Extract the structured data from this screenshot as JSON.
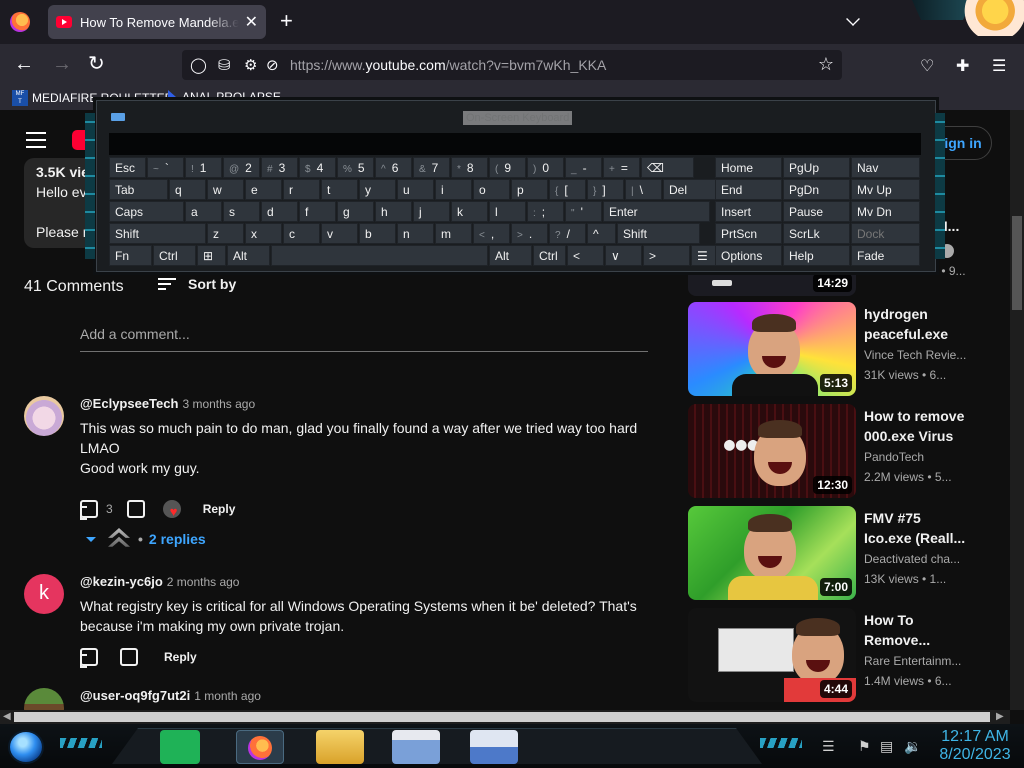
{
  "browser": {
    "tab_title": "How To Remove Mandela.exe (",
    "tab_close": "✕",
    "new_tab": "+",
    "url_prefix": "https://www.",
    "url_domain": "youtube.com",
    "url_path": "/watch?v=bvm7wKh_KKA",
    "bookmarks": [
      "MEDIAFIRE ROULETTER",
      "ANAL PROLAPSE"
    ]
  },
  "youtube": {
    "sign_in": "Sign in",
    "desc_lines": [
      "3.5K vie",
      "Hello eve",
      "Please r"
    ],
    "comments_count": "41 Comments",
    "sort_by": "Sort by",
    "add_comment_placeholder": "Add a comment...",
    "comments": [
      {
        "author": "@EclypseeTech",
        "time": "3 months ago",
        "text": [
          "This was so much pain to do man, glad you finally found a way after we tried way too hard",
          "LMAO",
          "Good work my guy."
        ],
        "likes": "3",
        "reply": "Reply"
      },
      {
        "author": "@kezin-yc6jo",
        "time": "2 months ago",
        "avatar_letter": "k",
        "text": [
          "What registry key is critical for all Windows Operating Systems when it be' deleted?  That's",
          "because i'm making my own private trojan."
        ],
        "reply": "Reply"
      },
      {
        "author": "@user-oq9fg7ut2i",
        "time": "1 month ago"
      }
    ],
    "replies_label": "2 replies",
    "recommended": [
      {
        "title_line1": "hydrogen",
        "title_line2": "peaceful.exe",
        "channel": "Vince Tech Revie...",
        "meta": "31K views • 6...",
        "duration": "5:13"
      },
      {
        "title_line1": "How to remove",
        "title_line2": "000.exe Virus",
        "channel": "PandoTech",
        "meta": "2.2M views • 5...",
        "duration": "12:30"
      },
      {
        "title_line1": "FMV #75",
        "title_line2": "Ico.exe (Reall...",
        "channel": "Deactivated cha...",
        "meta": "13K views • 1...",
        "duration": "7:00"
      },
      {
        "title_line1": "How To",
        "title_line2": "Remove...",
        "channel": "Rare Entertainm...",
        "meta": "1.4M views • 6...",
        "duration": "4:44"
      }
    ],
    "partial_top_rec": {
      "duration": "14:29",
      "title_peek": "M...",
      "meta_peek": "... • 9..."
    }
  },
  "keyboard": {
    "title": "On-Screen Keyboard",
    "rows": [
      [
        {
          "l": "Esc"
        },
        {
          "s": "~",
          "l": "`"
        },
        {
          "s": "!",
          "l": "1"
        },
        {
          "s": "@",
          "l": "2"
        },
        {
          "s": "#",
          "l": "3"
        },
        {
          "s": "$",
          "l": "4"
        },
        {
          "s": "%",
          "l": "5"
        },
        {
          "s": "^",
          "l": "6"
        },
        {
          "s": "&",
          "l": "7"
        },
        {
          "s": "*",
          "l": "8"
        },
        {
          "s": "(",
          "l": "9"
        },
        {
          "s": ")",
          "l": "0"
        },
        {
          "s": "_",
          "l": "-"
        },
        {
          "s": "+",
          "l": "="
        },
        {
          "l": "⌫"
        }
      ],
      [
        {
          "l": "Tab"
        },
        {
          "l": "q"
        },
        {
          "l": "w"
        },
        {
          "l": "e"
        },
        {
          "l": "r"
        },
        {
          "l": "t"
        },
        {
          "l": "y"
        },
        {
          "l": "u"
        },
        {
          "l": "i"
        },
        {
          "l": "o"
        },
        {
          "l": "p"
        },
        {
          "s": "{",
          "l": "["
        },
        {
          "s": "}",
          "l": "]"
        },
        {
          "s": "|",
          "l": "\\"
        },
        {
          "l": "Del"
        }
      ],
      [
        {
          "l": "Caps"
        },
        {
          "l": "a"
        },
        {
          "l": "s"
        },
        {
          "l": "d"
        },
        {
          "l": "f"
        },
        {
          "l": "g"
        },
        {
          "l": "h"
        },
        {
          "l": "j"
        },
        {
          "l": "k"
        },
        {
          "l": "l"
        },
        {
          "s": ":",
          "l": ";"
        },
        {
          "s": "\"",
          "l": "'"
        },
        {
          "l": "Enter"
        }
      ],
      [
        {
          "l": "Shift"
        },
        {
          "l": "z"
        },
        {
          "l": "x"
        },
        {
          "l": "c"
        },
        {
          "l": "v"
        },
        {
          "l": "b"
        },
        {
          "l": "n"
        },
        {
          "l": "m"
        },
        {
          "s": "<",
          "l": ","
        },
        {
          "s": ">",
          "l": "."
        },
        {
          "s": "?",
          "l": "/"
        },
        {
          "l": "^"
        },
        {
          "l": "Shift"
        }
      ],
      [
        {
          "l": "Fn"
        },
        {
          "l": "Ctrl"
        },
        {
          "l": "⊞"
        },
        {
          "l": "Alt"
        },
        {
          "l": ""
        },
        {
          "l": "Alt"
        },
        {
          "l": "Ctrl"
        },
        {
          "l": "<"
        },
        {
          "l": "∨"
        },
        {
          "l": ">"
        },
        {
          "l": "☰"
        }
      ]
    ],
    "nav_keys": [
      [
        "Home",
        "PgUp",
        "Nav"
      ],
      [
        "End",
        "PgDn",
        "Mv Up"
      ],
      [
        "Insert",
        "Pause",
        "Mv Dn"
      ],
      [
        "PrtScn",
        "ScrLk",
        "Dock"
      ],
      [
        "Options",
        "Help",
        "Fade"
      ]
    ]
  },
  "taskbar": {
    "time": "12:17 AM",
    "date": "8/20/2023"
  },
  "colors": {
    "accent": "#3ea6ff",
    "youtube_red": "#ff0033",
    "clock": "#3fb5e6"
  }
}
